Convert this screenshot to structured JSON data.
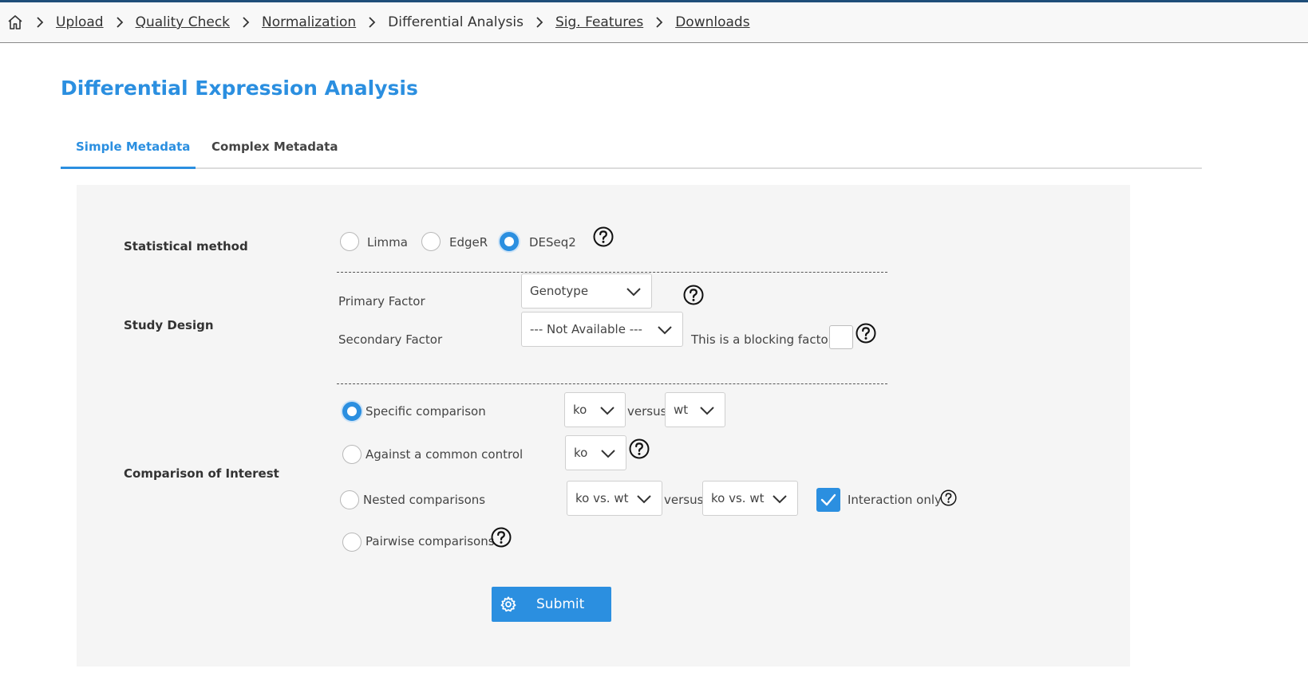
{
  "breadcrumb": {
    "home_icon": "home-icon",
    "items": [
      {
        "label": "Upload",
        "link": true
      },
      {
        "label": "Quality Check",
        "link": true
      },
      {
        "label": "Normalization",
        "link": true
      },
      {
        "label": "Differential Analysis",
        "link": false
      },
      {
        "label": "Sig. Features",
        "link": true
      },
      {
        "label": "Downloads",
        "link": true
      }
    ]
  },
  "page": {
    "title": "Differential Expression Analysis"
  },
  "tabs": [
    {
      "label": "Simple Metadata",
      "active": true
    },
    {
      "label": "Complex Metadata",
      "active": false
    }
  ],
  "form": {
    "statistical_method": {
      "label": "Statistical method",
      "options": [
        "Limma",
        "EdgeR",
        "DESeq2"
      ],
      "selected": "DESeq2"
    },
    "study_design": {
      "label": "Study Design",
      "primary_label": "Primary Factor",
      "primary_value": "Genotype",
      "secondary_label": "Secondary Factor",
      "secondary_value": "--- Not Available ---",
      "blocking_label": "This is a blocking factor",
      "blocking_checked": false
    },
    "comparison": {
      "label": "Comparison of Interest",
      "selected": "Specific comparison",
      "specific_label": "Specific comparison",
      "specific_a": "ko",
      "specific_versus": "versus",
      "specific_b": "wt",
      "common_label": "Against a common control",
      "common_value": "ko",
      "nested_label": "Nested comparisons",
      "nested_a": "ko vs. wt",
      "nested_versus": "versus",
      "nested_b": "ko vs. wt",
      "interaction_label": "Interaction only",
      "interaction_checked": true,
      "pairwise_label": "Pairwise comparisons"
    },
    "submit_label": "Submit"
  },
  "colors": {
    "accent": "#2b8fe0",
    "topbar_border": "#1f4e79",
    "panel_bg": "#f5f5f5"
  }
}
